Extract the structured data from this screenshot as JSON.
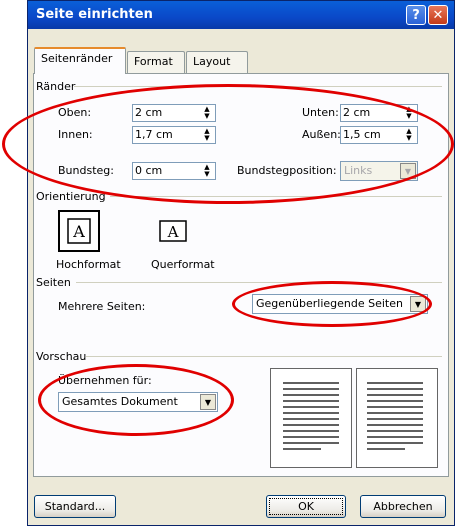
{
  "window": {
    "title": "Seite einrichten",
    "help_label": "?",
    "close_label": "✕"
  },
  "tabs": [
    {
      "label": "Seitenränder",
      "active": true
    },
    {
      "label": "Format",
      "active": false
    },
    {
      "label": "Layout",
      "active": false
    }
  ],
  "margins": {
    "group_label": "Ränder",
    "top": {
      "label": "Oben:",
      "value": "2 cm"
    },
    "bottom": {
      "label": "Unten:",
      "value": "2 cm"
    },
    "inner": {
      "label": "Innen:",
      "value": "1,7 cm"
    },
    "outer": {
      "label": "Außen:",
      "value": "1,5 cm"
    },
    "gutter": {
      "label": "Bundsteg:",
      "value": "0 cm"
    },
    "gutter_position": {
      "label": "Bundstegposition:",
      "value": "Links",
      "disabled": true
    }
  },
  "orientation": {
    "group_label": "Orientierung",
    "portrait_label": "Hochformat",
    "landscape_label": "Querformat",
    "icon_glyph": "A"
  },
  "pages": {
    "group_label": "Seiten",
    "multiple_label": "Mehrere Seiten:",
    "multiple_value": "Gegenüberliegende Seiten"
  },
  "preview": {
    "group_label": "Vorschau",
    "apply_label": "Übernehmen für:",
    "apply_value": "Gesamtes Dokument"
  },
  "buttons": {
    "default_label": "Standard...",
    "ok_label": "OK",
    "cancel_label": "Abbrechen"
  },
  "colors": {
    "annotation_red": "#e00000",
    "title_blue": "#0a48c8"
  }
}
